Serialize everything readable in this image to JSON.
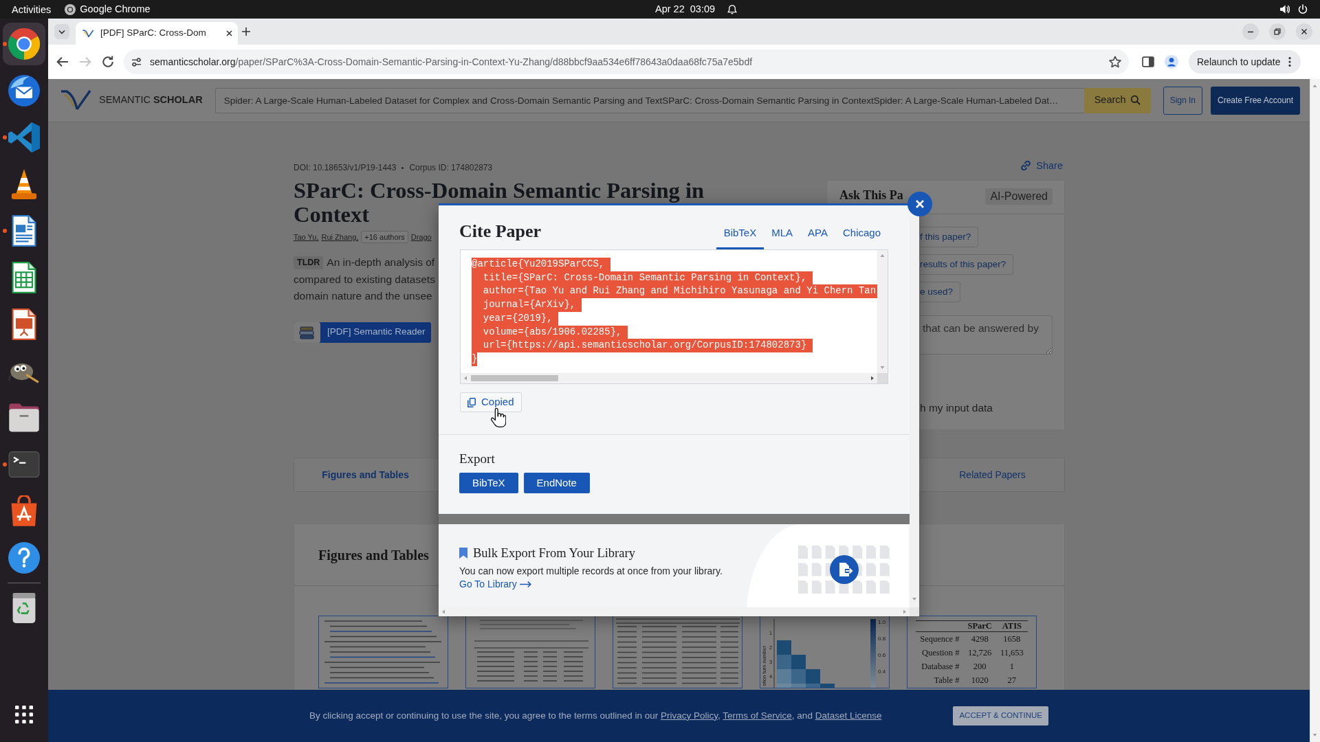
{
  "system_bar": {
    "activities": "Activities",
    "app_name": "Google Chrome",
    "clock": "Apr 22  03:09"
  },
  "dock": {
    "items": [
      {
        "kind": "browser",
        "running": true,
        "selected": true
      },
      {
        "kind": "mail",
        "running": false,
        "selected": false
      },
      {
        "kind": "code_editor",
        "running": true,
        "selected": false
      },
      {
        "kind": "media_player",
        "running": false,
        "selected": false
      },
      {
        "kind": "writer",
        "running": true,
        "selected": false
      },
      {
        "kind": "spreadsheet",
        "running": false,
        "selected": false
      },
      {
        "kind": "presentation",
        "running": false,
        "selected": false
      },
      {
        "kind": "image_editor",
        "running": false,
        "selected": false
      },
      {
        "kind": "files",
        "running": false,
        "selected": false
      },
      {
        "kind": "terminal",
        "running": true,
        "selected": false
      },
      {
        "kind": "app_store",
        "running": false,
        "selected": false
      },
      {
        "kind": "help",
        "running": false,
        "selected": false
      },
      {
        "kind": "trash",
        "running": false,
        "selected": false
      }
    ]
  },
  "browser": {
    "tabs": [
      {
        "title": "[PDF] SParC: Cross-Dom",
        "selected": true
      }
    ],
    "nav_buttons": [
      {
        "kind": "back",
        "disabled": false
      },
      {
        "kind": "forward",
        "disabled": true
      },
      {
        "kind": "reload",
        "disabled": false
      }
    ],
    "address": {
      "host": "semanticscholar.org",
      "path": "/paper/SParC%3A-Cross-Domain-Semantic-Parsing-in-Context-Yu-Zhang/d88bbcf9aa534e6ff78643a0daa68fc75a7e5bdf"
    },
    "relaunch_button": "Relaunch to update"
  },
  "site_header": {
    "logo": "SEMANTIC **SCHOLAR**",
    "search": {
      "value": "Spider: A Large-Scale Human-Labeled Dataset for Complex and Cross-Domain Semantic Parsing and TextSParC: Cross-Domain Semantic Parsing in ContextSpider: A Large-Scale Human-Labeled Dat…"
    },
    "search_button": "Search",
    "sign_in": "Sign In",
    "create_account": "Create Free Account"
  },
  "paper": {
    "doi": "DOI: 10.18653/v1/P19-1443",
    "corpus_id": "Corpus ID: 174802873",
    "title_lines": [
      "SParC: Cross-Domain Semantic Parsing in",
      "Context"
    ],
    "authors": [
      "Tao Yu,",
      "Rui Zhang,"
    ],
    "more_authors": "+16 authors",
    "next_author": "Drago",
    "tldr": {
      "label": "TLDR",
      "lines": [
        "An in-depth analysis of",
        "compared to existing datasets",
        "domain nature and the unsee"
      ]
    },
    "reader_button": "[PDF] Semantic Reader",
    "share": "Share"
  },
  "ask_panel": {
    "title": "Ask This Pa",
    "tag": "AI-Powered",
    "questions": [
      "f this paper?",
      "results of this paper?",
      "e used?"
    ],
    "question_input": {
      "placeholder": "that can be answered by"
    },
    "consent": "h my input data"
  },
  "section_tabs": [
    {
      "label": "Figures and Tables",
      "selected": true
    },
    {
      "label": "Related Papers",
      "selected": false
    }
  ],
  "figures": {
    "title": "Figures and Tables",
    "thumbnails": [
      {
        "kind": "text_page"
      },
      {
        "kind": "table_page"
      },
      {
        "kind": "text_table"
      },
      {
        "kind": "heatmap",
        "axis_label": "stion turn number",
        "row_labels": [
          "1",
          "2",
          "3",
          "4"
        ],
        "colorbar_labels": [
          "1.0",
          "0.8",
          "0.6",
          "0.4"
        ]
      },
      {
        "kind": "data_table",
        "columns": [
          "",
          "SParC",
          "ATIS"
        ],
        "rows": [
          [
            "Sequence #",
            "4298",
            "1658"
          ],
          [
            "Question #",
            "12,726",
            "11,653"
          ],
          [
            "Database #",
            "200",
            "1"
          ],
          [
            "Table #",
            "1020",
            "27"
          ]
        ]
      }
    ]
  },
  "cite_modal": {
    "title": "Cite Paper",
    "formats": [
      {
        "label": "BibTeX",
        "selected": true
      },
      {
        "label": "MLA",
        "selected": false
      },
      {
        "label": "APA",
        "selected": false
      },
      {
        "label": "Chicago",
        "selected": false
      }
    ],
    "citation": {
      "selected": true,
      "lines": [
        "@article{Yu2019SParCCS,",
        "  title={SParC: Cross-Domain Semantic Parsing in Context},",
        "  author={Tao Yu and Rui Zhang and Michihiro Yasunaga and Yi Chern Tan",
        "  journal={ArXiv},",
        "  year={2019},",
        "  volume={abs/1906.02285},",
        "  url={https://api.semanticscholar.org/CorpusID:174802873}",
        "}"
      ]
    },
    "copy_button": "Copied",
    "export": {
      "title": "Export",
      "buttons": [
        "BibTeX",
        "EndNote"
      ]
    },
    "bulk_export": {
      "title": "Bulk Export From Your Library",
      "text": "You can now export multiple records at once from your library.",
      "link": "Go To Library"
    }
  },
  "cookie_banner": {
    "parts": [
      {
        "kind": "text",
        "text": "By clicking accept or continuing to use the site, you agree to the terms outlined in our "
      },
      {
        "kind": "link",
        "text": "Privacy Policy"
      },
      {
        "kind": "text",
        "text": ", "
      },
      {
        "kind": "link",
        "text": "Terms of Service"
      },
      {
        "kind": "text",
        "text": ", and "
      },
      {
        "kind": "link",
        "text": "Dataset License"
      }
    ],
    "button": "ACCEPT & CONTINUE"
  }
}
